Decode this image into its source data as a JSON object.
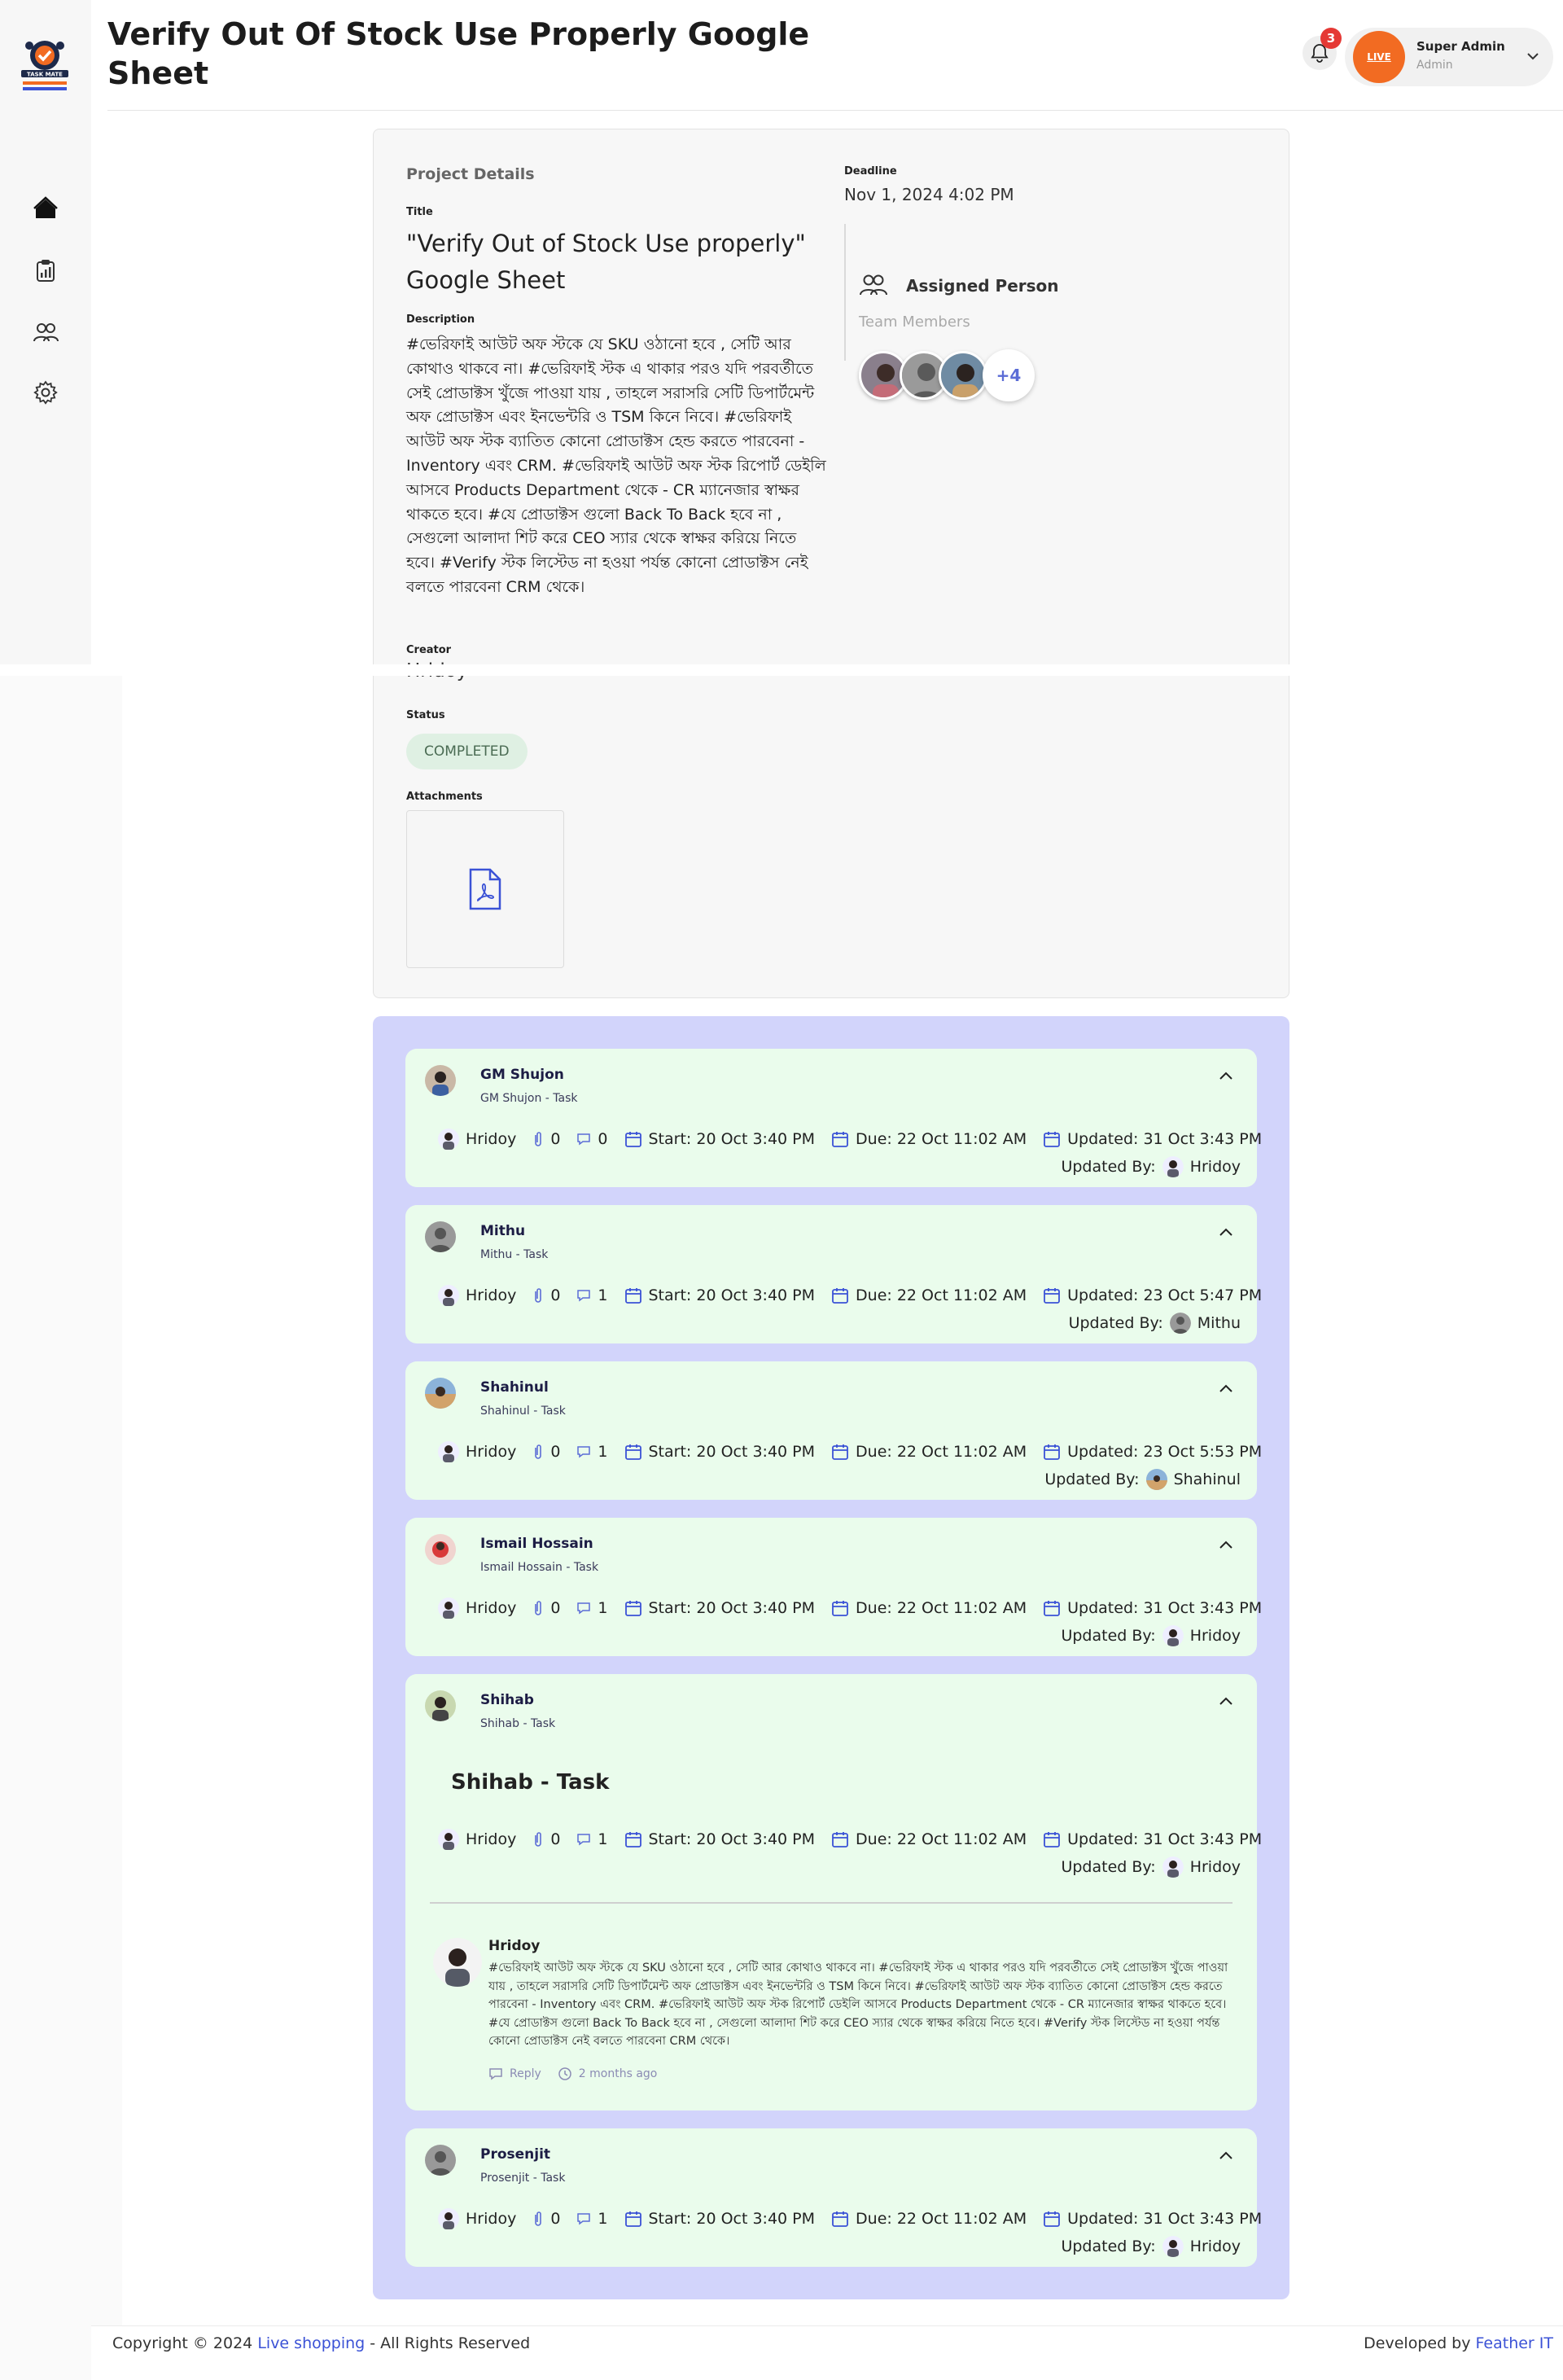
{
  "app": {
    "logo_text": "TASK MATE"
  },
  "header": {
    "title": "Verify Out Of Stock Use Properly Google Sheet",
    "notification_count": "3",
    "user": {
      "avatar_text": "LIVE",
      "name": "Super Admin",
      "role": "Admin"
    }
  },
  "sidebar": {
    "items": [
      {
        "icon": "home-icon"
      },
      {
        "icon": "report-icon"
      },
      {
        "icon": "users-icon"
      },
      {
        "icon": "settings-icon"
      }
    ]
  },
  "project": {
    "heading": "Project Details",
    "title_label": "Title",
    "title": "\"Verify Out of Stock Use properly\" Google Sheet",
    "description_label": "Description",
    "description": "#ভেরিফাই আউট অফ স্টকে যে SKU ওঠানো হবে , সেটি আর কোথাও থাকবে না। #ভেরিফাই স্টক এ থাকার পরও যদি পরবর্তীতে সেই প্রোডাক্টস খুঁজে পাওয়া যায় , তাহলে সরাসরি সেটি ডিপার্টমেন্ট অফ প্রোডাক্টস এবং ইনভেন্টরি ও TSM কিনে নিবে। #ভেরিফাই আউট অফ স্টক ব্যাতিত কোনো প্রোডাক্টস হেন্ড করতে পারবেনা - Inventory এবং CRM. #ভেরিফাই আউট অফ স্টক রিপোর্ট ডেইলি আসবে Products Department থেকে - CR ম্যানেজার স্বাক্ষর থাকতে হবে। #যে প্রোডাক্টস গুলো Back To Back হবে না , সেগুলো আলাদা শিট করে CEO স্যার থেকে স্বাক্ষর করিয়ে নিতে হবে। #Verify স্টক লিস্টেড না হওয়া পর্যন্ত কোনো প্রোডাক্টস নেই বলতে পারবেনা CRM থেকে।",
    "creator_label": "Creator",
    "creator": "Hridoy",
    "status_label": "Status",
    "status": "COMPLETED",
    "attachments_label": "Attachments",
    "attachment_icon": "pdf-icon",
    "deadline_label": "Deadline",
    "deadline": "Nov 1, 2024 4:02 PM",
    "assigned_title": "Assigned Person",
    "team_label": "Team Members",
    "more_members": "+4"
  },
  "tasks": [
    {
      "name": "GM Shujon",
      "subtitle": "GM Shujon - Task",
      "creator": "Hridoy",
      "attachments": "0",
      "comments": "0",
      "start": "Start: 20 Oct 3:40 PM",
      "due": "Due: 22 Oct 11:02 AM",
      "updated": "Updated: 31 Oct 3:43 PM",
      "updated_by_label": "Updated By:",
      "updated_by": "Hridoy"
    },
    {
      "name": "Mithu",
      "subtitle": "Mithu - Task",
      "creator": "Hridoy",
      "attachments": "0",
      "comments": "1",
      "start": "Start: 20 Oct 3:40 PM",
      "due": "Due: 22 Oct 11:02 AM",
      "updated": "Updated: 23 Oct 5:47 PM",
      "updated_by_label": "Updated By:",
      "updated_by": "Mithu"
    },
    {
      "name": "Shahinul",
      "subtitle": "Shahinul - Task",
      "creator": "Hridoy",
      "attachments": "0",
      "comments": "1",
      "start": "Start: 20 Oct 3:40 PM",
      "due": "Due: 22 Oct 11:02 AM",
      "updated": "Updated: 23 Oct 5:53 PM",
      "updated_by_label": "Updated By:",
      "updated_by": "Shahinul"
    },
    {
      "name": "Ismail Hossain",
      "subtitle": "Ismail Hossain - Task",
      "creator": "Hridoy",
      "attachments": "0",
      "comments": "1",
      "start": "Start: 20 Oct 3:40 PM",
      "due": "Due: 22 Oct 11:02 AM",
      "updated": "Updated: 31 Oct 3:43 PM",
      "updated_by_label": "Updated By:",
      "updated_by": "Hridoy"
    },
    {
      "name": "Shihab",
      "subtitle": "Shihab - Task",
      "heading": "Shihab - Task",
      "creator": "Hridoy",
      "attachments": "0",
      "comments": "1",
      "start": "Start: 20 Oct 3:40 PM",
      "due": "Due: 22 Oct 11:02 AM",
      "updated": "Updated: 31 Oct 3:43 PM",
      "updated_by_label": "Updated By:",
      "updated_by": "Hridoy",
      "comment": {
        "author": "Hridoy",
        "text": "#ভেরিফাই আউট অফ স্টকে যে SKU ওঠানো হবে , সেটি আর কোথাও থাকবে না। #ভেরিফাই স্টক এ থাকার পরও যদি পরবর্তীতে সেই প্রোডাক্টস খুঁজে পাওয়া যায় , তাহলে সরাসরি সেটি ডিপার্টমেন্ট অফ প্রোডাক্টস এবং ইনভেন্টরি ও TSM কিনে নিবে। #ভেরিফাই আউট অফ স্টক ব্যাতিত কোনো প্রোডাক্টস হেন্ড করতে পারবেনা - Inventory এবং CRM. #ভেরিফাই আউট অফ স্টক রিপোর্ট ডেইলি আসবে Products Department থেকে - CR ম্যানেজার স্বাক্ষর থাকতে হবে। #যে প্রোডাক্টস গুলো Back To Back হবে না , সেগুলো আলাদা শিট করে CEO স্যার থেকে স্বাক্ষর করিয়ে নিতে হবে। #Verify স্টক লিস্টেড না হওয়া পর্যন্ত কোনো প্রোডাক্টস নেই বলতে পারবেনা CRM থেকে।",
        "reply": "Reply",
        "time": "2 months ago"
      }
    },
    {
      "name": "Prosenjit",
      "subtitle": "Prosenjit - Task",
      "creator": "Hridoy",
      "attachments": "0",
      "comments": "1",
      "start": "Start: 20 Oct 3:40 PM",
      "due": "Due: 22 Oct 11:02 AM",
      "updated": "Updated: 31 Oct 3:43 PM",
      "updated_by_label": "Updated By:",
      "updated_by": "Hridoy"
    }
  ],
  "footer": {
    "copyright_prefix": "Copyright © 2024",
    "company": "Live shopping",
    "rights": "- All Rights Reserved",
    "developed_by": "Developed by",
    "developer": "Feather IT"
  },
  "colors": {
    "accent": "#3b52d6",
    "avatar": "#f26b22",
    "task_bg": "#eafcec",
    "panel_bg": "#d2d4fb",
    "status_bg": "#dff0e3"
  }
}
